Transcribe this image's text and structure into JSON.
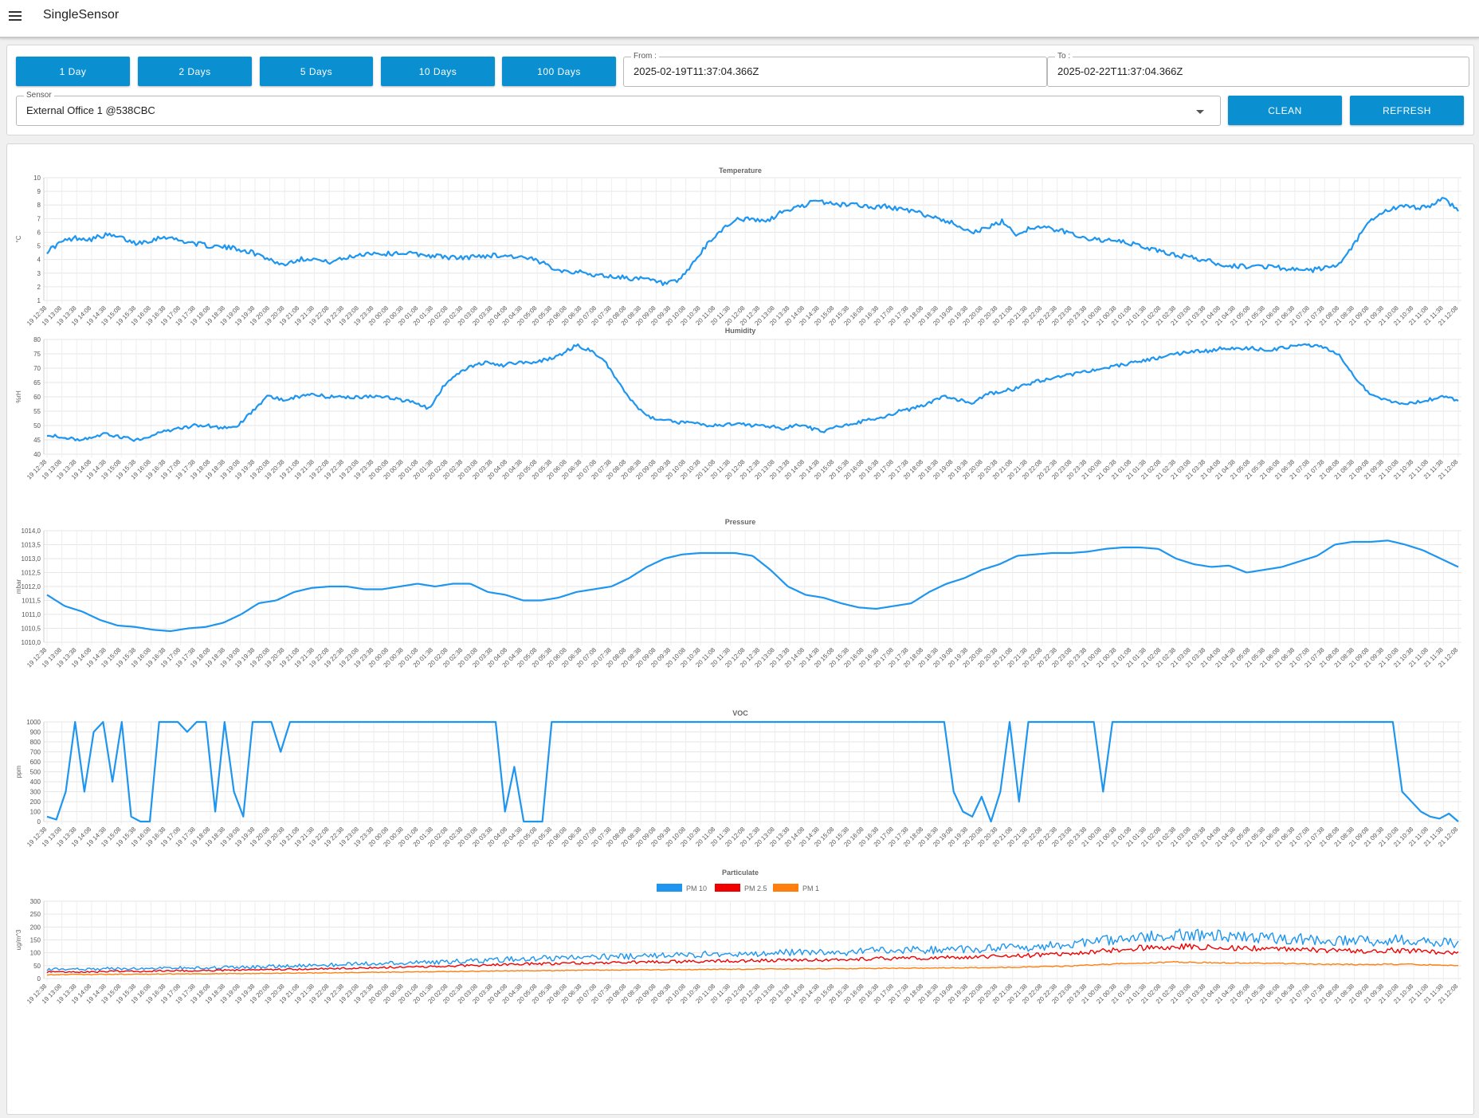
{
  "app": {
    "title": "SingleSensor"
  },
  "controls": {
    "range_buttons": [
      "1 Day",
      "2 Days",
      "5 Days",
      "10 Days",
      "100 Days"
    ],
    "from": {
      "label": "From :",
      "value": "2025-02-19T11:37:04.366Z"
    },
    "to": {
      "label": "To :",
      "value": "2025-02-22T11:37:04.366Z"
    },
    "sensor": {
      "label": "Sensor",
      "value": "External Office 1 @538CBC"
    },
    "clean_label": "CLEAN",
    "refresh_label": "REFRESH"
  },
  "colors": {
    "accent": "#0a8fd1",
    "line": "#1e96f0",
    "pm10": "#1e96f0",
    "pm25": "#f00000",
    "pm1": "#ff7f0e"
  },
  "time_labels": [
    "19 12:38",
    "19 13:08",
    "19 13:38",
    "19 14:08",
    "19 14:38",
    "19 15:08",
    "19 15:38",
    "19 16:08",
    "19 16:38",
    "19 17:08",
    "19 17:38",
    "19 18:08",
    "19 18:38",
    "19 19:08",
    "19 19:38",
    "19 20:08",
    "19 20:38",
    "19 21:08",
    "19 21:38",
    "19 22:08",
    "19 22:38",
    "19 23:08",
    "19 23:38",
    "20 00:08",
    "20 00:38",
    "20 01:08",
    "20 01:38",
    "20 02:08",
    "20 02:38",
    "20 03:08",
    "20 03:38",
    "20 04:08",
    "20 04:38",
    "20 05:08",
    "20 05:38",
    "20 06:08",
    "20 06:38",
    "20 07:08",
    "20 07:38",
    "20 08:08",
    "20 08:38",
    "20 09:08",
    "20 09:38",
    "20 10:08",
    "20 10:38",
    "20 11:08",
    "20 11:38",
    "20 12:08",
    "20 12:38",
    "20 13:08",
    "20 13:38",
    "20 14:08",
    "20 14:38",
    "20 15:08",
    "20 15:38",
    "20 16:08",
    "20 16:38",
    "20 17:08",
    "20 17:38",
    "20 18:08",
    "20 18:38",
    "20 19:08",
    "20 19:38",
    "20 20:08",
    "20 20:38",
    "20 21:08",
    "20 21:38",
    "20 22:08",
    "20 22:38",
    "20 23:08",
    "20 23:38",
    "21 00:08",
    "21 00:38",
    "21 01:08",
    "21 01:38",
    "21 02:08",
    "21 02:38",
    "21 03:08",
    "21 03:38",
    "21 04:08",
    "21 04:38",
    "21 05:08",
    "21 05:38",
    "21 06:08",
    "21 06:38",
    "21 07:08",
    "21 07:38",
    "21 08:08",
    "21 08:38",
    "21 09:08",
    "21 09:38",
    "21 10:08",
    "21 10:38",
    "21 11:08",
    "21 11:38",
    "21 12:08"
  ],
  "chart_data": [
    {
      "type": "line",
      "title": "Temperature",
      "ylabel": "°C",
      "ylim": [
        1,
        10
      ],
      "yticks": [
        "1",
        "2",
        "3",
        "4",
        "5",
        "6",
        "7",
        "8",
        "9",
        "10"
      ],
      "series": [
        {
          "color": "#1e96f0",
          "values": [
            4.6,
            5.3,
            5.6,
            5.5,
            5.8,
            5.6,
            5.2,
            5.4,
            5.7,
            5.4,
            5.2,
            5.0,
            4.9,
            4.8,
            4.5,
            4.1,
            3.6,
            4.0,
            4.1,
            3.8,
            4.0,
            4.3,
            4.5,
            4.4,
            4.5,
            4.4,
            4.3,
            4.2,
            4.1,
            4.2,
            4.3,
            4.3,
            4.2,
            4.0,
            3.6,
            3.2,
            3.1,
            2.9,
            2.8,
            2.7,
            2.6,
            2.5,
            2.2,
            2.4,
            3.8,
            5.2,
            6.3,
            7.0,
            6.9,
            6.8,
            7.5,
            7.8,
            8.2,
            8.2,
            8.0,
            8.1,
            7.8,
            7.9,
            7.7,
            7.5,
            7.2,
            6.9,
            6.5,
            6.0,
            6.3,
            6.8,
            5.8,
            6.4,
            6.3,
            6.1,
            5.8,
            5.5,
            5.4,
            5.3,
            5.1,
            4.8,
            4.5,
            4.3,
            4.1,
            3.9,
            3.6,
            3.5,
            3.5,
            3.5,
            3.4,
            3.2,
            3.2,
            3.4,
            3.6,
            5.3,
            6.8,
            7.5,
            7.9,
            7.8,
            7.9,
            8.5,
            7.6
          ]
        }
      ]
    },
    {
      "type": "line",
      "title": "Humidity",
      "ylabel": "%rH",
      "ylim": [
        40,
        80
      ],
      "yticks": [
        "40",
        "45",
        "50",
        "55",
        "60",
        "65",
        "70",
        "75",
        "80"
      ],
      "series": [
        {
          "color": "#1e96f0",
          "values": [
            47,
            46,
            45,
            46,
            47,
            46,
            45,
            46,
            48,
            49,
            50,
            50,
            49,
            50,
            55,
            60,
            59,
            60,
            61,
            60,
            60,
            60,
            60,
            60,
            59,
            58,
            56,
            64,
            68,
            71,
            72,
            71,
            72,
            72,
            73,
            75,
            78,
            76,
            72,
            64,
            57,
            53,
            52,
            51,
            51,
            50,
            50,
            51,
            50,
            50,
            49,
            50,
            49,
            48,
            50,
            51,
            52,
            53,
            55,
            56,
            58,
            60,
            59,
            58,
            61,
            62,
            63,
            65,
            66,
            67,
            68,
            69,
            70,
            71,
            72,
            73,
            74,
            75,
            76,
            76,
            77,
            77,
            77,
            76,
            77,
            78,
            78,
            77,
            74,
            66,
            61,
            59,
            58,
            58,
            59,
            60,
            59
          ]
        }
      ]
    },
    {
      "type": "line",
      "title": "Pressure",
      "ylabel": "mbar",
      "ylim": [
        1010.0,
        1014.0
      ],
      "yticks": [
        "1010,0",
        "1010,5",
        "1011,0",
        "1011,5",
        "1012,0",
        "1012,5",
        "1013,0",
        "1013,5",
        "1014,0"
      ],
      "series": [
        {
          "color": "#1e96f0",
          "values": [
            1011.7,
            1011.3,
            1011.1,
            1010.8,
            1010.6,
            1010.55,
            1010.45,
            1010.4,
            1010.5,
            1010.55,
            1010.7,
            1011.0,
            1011.4,
            1011.5,
            1011.8,
            1011.95,
            1012.0,
            1012.0,
            1011.9,
            1011.9,
            1012.0,
            1012.1,
            1012.0,
            1012.1,
            1012.1,
            1011.8,
            1011.7,
            1011.5,
            1011.5,
            1011.6,
            1011.8,
            1011.9,
            1012.0,
            1012.3,
            1012.7,
            1013.0,
            1013.15,
            1013.2,
            1013.2,
            1013.2,
            1013.1,
            1012.6,
            1012.0,
            1011.7,
            1011.6,
            1011.4,
            1011.25,
            1011.2,
            1011.3,
            1011.4,
            1011.8,
            1012.1,
            1012.3,
            1012.6,
            1012.8,
            1013.1,
            1013.15,
            1013.2,
            1013.2,
            1013.25,
            1013.35,
            1013.4,
            1013.4,
            1013.35,
            1013.0,
            1012.8,
            1012.7,
            1012.75,
            1012.5,
            1012.6,
            1012.7,
            1012.9,
            1013.1,
            1013.5,
            1013.6,
            1013.6,
            1013.65,
            1013.5,
            1013.3,
            1013.0,
            1012.7
          ]
        }
      ]
    },
    {
      "type": "line",
      "title": "VOC",
      "ylabel": "ppm",
      "ylim": [
        0,
        1000
      ],
      "yticks": [
        "0",
        "100",
        "200",
        "300",
        "400",
        "500",
        "600",
        "700",
        "800",
        "900",
        "1000"
      ],
      "series": [
        {
          "color": "#1e96f0",
          "values": [
            50,
            20,
            300,
            1000,
            300,
            900,
            1000,
            400,
            1000,
            50,
            0,
            0,
            1000,
            1000,
            1000,
            900,
            1000,
            1000,
            100,
            1000,
            300,
            50,
            1000,
            1000,
            1000,
            700,
            1000,
            1000,
            1000,
            1000,
            1000,
            1000,
            1000,
            1000,
            1000,
            1000,
            1000,
            1000,
            1000,
            1000,
            1000,
            1000,
            1000,
            1000,
            1000,
            1000,
            1000,
            1000,
            1000,
            100,
            550,
            0,
            0,
            0,
            1000,
            1000,
            1000,
            1000,
            1000,
            1000,
            1000,
            1000,
            1000,
            1000,
            1000,
            1000,
            1000,
            1000,
            1000,
            1000,
            1000,
            1000,
            1000,
            1000,
            1000,
            1000,
            1000,
            1000,
            1000,
            1000,
            1000,
            1000,
            1000,
            1000,
            1000,
            1000,
            1000,
            1000,
            1000,
            1000,
            1000,
            1000,
            1000,
            1000,
            1000,
            1000,
            1000,
            300,
            100,
            50,
            250,
            0,
            300,
            1000,
            200,
            1000,
            1000,
            1000,
            1000,
            1000,
            1000,
            1000,
            1000,
            300,
            1000,
            1000,
            1000,
            1000,
            1000,
            1000,
            1000,
            1000,
            1000,
            1000,
            1000,
            1000,
            1000,
            1000,
            1000,
            1000,
            1000,
            1000,
            1000,
            1000,
            1000,
            1000,
            1000,
            1000,
            1000,
            1000,
            1000,
            1000,
            1000,
            1000,
            1000,
            300,
            200,
            100,
            50,
            30,
            80,
            0
          ]
        }
      ]
    },
    {
      "type": "line",
      "title": "Particulate",
      "ylabel": "ug/m^3",
      "ylim": [
        0,
        300
      ],
      "yticks": [
        "0",
        "50",
        "100",
        "150",
        "200",
        "250",
        "300"
      ],
      "legend": "top-center",
      "series": [
        {
          "name": "PM 10",
          "color": "#1e96f0",
          "values": [
            35,
            38,
            36,
            40,
            38,
            40,
            42,
            40,
            44,
            45,
            48,
            50,
            52,
            55,
            58,
            60,
            62,
            65,
            68,
            70,
            75,
            78,
            80,
            82,
            85,
            85,
            88,
            90,
            92,
            95,
            95,
            98,
            100,
            100,
            102,
            105,
            108,
            110,
            110,
            112,
            115,
            118,
            120,
            125,
            130,
            140,
            150,
            160,
            165,
            170,
            168,
            165,
            160,
            158,
            155,
            150,
            148,
            145,
            150,
            148,
            142,
            138
          ]
        },
        {
          "name": "PM 2.5",
          "color": "#f00000",
          "values": [
            25,
            27,
            26,
            28,
            28,
            30,
            31,
            30,
            33,
            33,
            35,
            36,
            38,
            40,
            42,
            44,
            46,
            48,
            50,
            52,
            55,
            57,
            58,
            60,
            62,
            62,
            64,
            65,
            67,
            68,
            69,
            70,
            72,
            72,
            74,
            75,
            78,
            79,
            80,
            82,
            84,
            86,
            88,
            92,
            96,
            102,
            110,
            118,
            122,
            125,
            122,
            120,
            118,
            116,
            114,
            110,
            108,
            106,
            110,
            108,
            104,
            100
          ]
        },
        {
          "name": "PM 1",
          "color": "#ff7f0e",
          "values": [
            15,
            16,
            16,
            17,
            17,
            18,
            18,
            18,
            19,
            20,
            21,
            21,
            22,
            23,
            24,
            25,
            26,
            27,
            28,
            29,
            30,
            31,
            31,
            32,
            33,
            33,
            34,
            35,
            35,
            36,
            36,
            37,
            37,
            38,
            38,
            39,
            40,
            40,
            41,
            42,
            42,
            43,
            44,
            46,
            48,
            52,
            56,
            60,
            62,
            64,
            62,
            61,
            60,
            59,
            58,
            56,
            55,
            54,
            56,
            55,
            53,
            50
          ]
        }
      ]
    }
  ]
}
